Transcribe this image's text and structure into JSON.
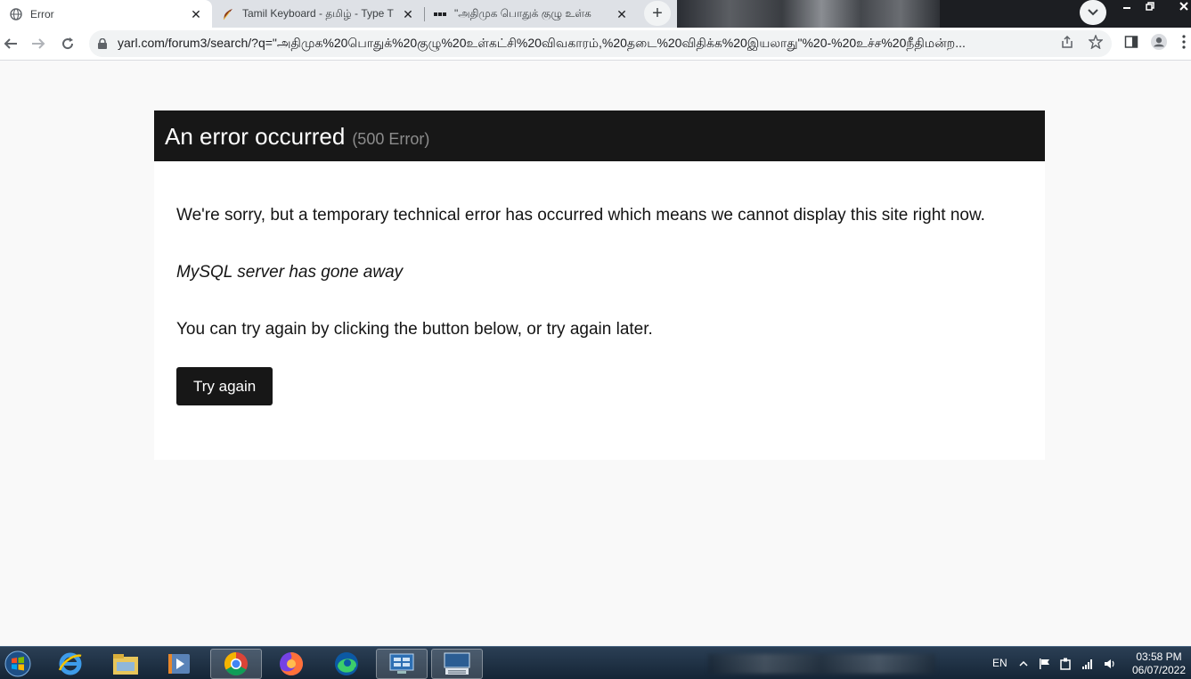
{
  "browser": {
    "tabs": [
      {
        "title": "Error",
        "active": true,
        "icon": "globe-icon"
      },
      {
        "title": "Tamil Keyboard - தமிழ் - Type T",
        "active": false,
        "icon": "feather-icon"
      },
      {
        "title": "\"அதிமுக பொதுக் குழு உள்க",
        "active": false,
        "icon": "ellipsis-icon"
      }
    ],
    "new_tab_label": "+",
    "url": "yarl.com/forum3/search/?q=\"அதிமுக%20பொதுக்%20குழு%20உள்கட்சி%20விவகாரம்,%20தடை%20விதிக்க%20இயலாது\"%20-%20உச்ச%20நீதிமன்ற..."
  },
  "error_page": {
    "title": "An error occurred",
    "code": "(500 Error)",
    "message": "We're sorry, but a temporary technical error has occurred which means we cannot display this site right now.",
    "detail": "MySQL server has gone away",
    "hint": "You can try again by clicking the button below, or try again later.",
    "button_label": "Try again"
  },
  "taskbar": {
    "apps": [
      "internet-explorer-icon",
      "file-explorer-icon",
      "media-player-icon",
      "chrome-icon",
      "firefox-icon",
      "edge-icon",
      "control-panel-icon",
      "keyboard-app-icon"
    ],
    "language": "EN",
    "time": "03:58 PM",
    "date": "06/07/2022"
  },
  "colors": {
    "header_bg": "#171717",
    "page_bg": "#f9f9f9",
    "code_text": "#8c8c8c"
  }
}
